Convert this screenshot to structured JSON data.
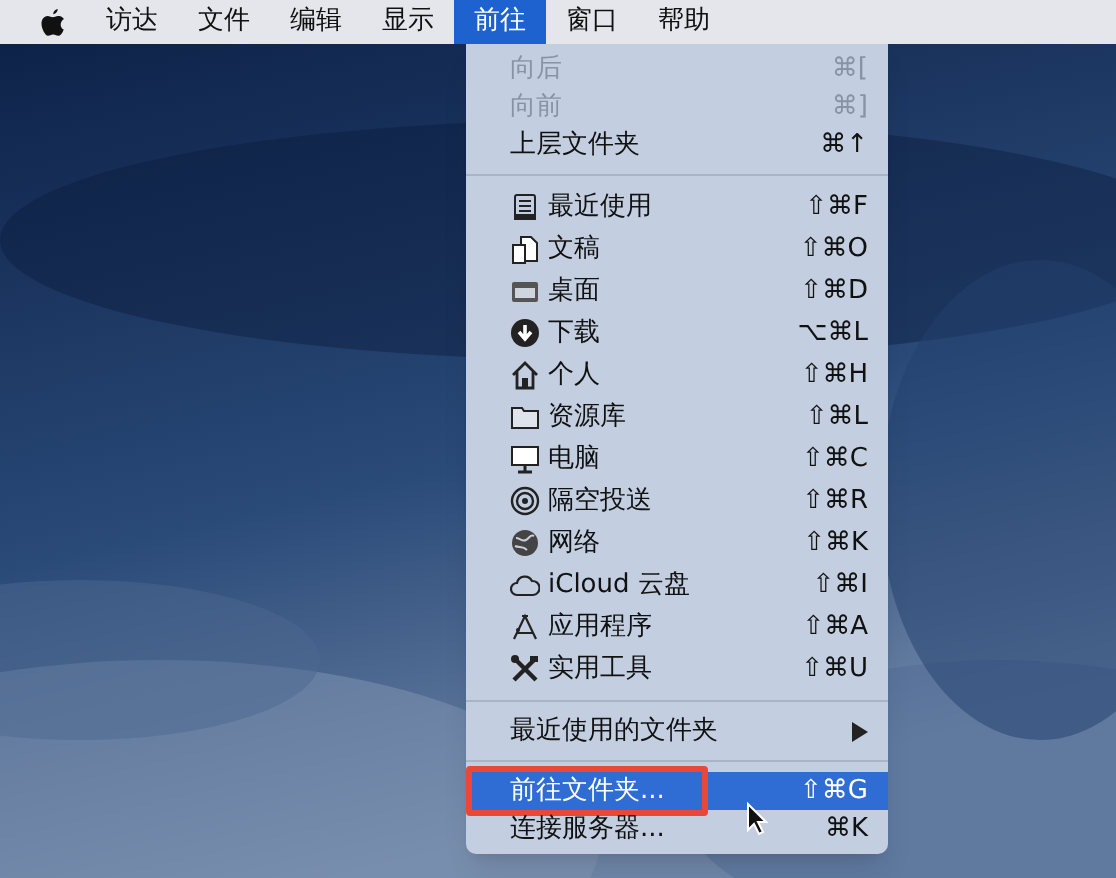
{
  "menu_bar": [
    {
      "label": "访达",
      "selected": false
    },
    {
      "label": "文件",
      "selected": false
    },
    {
      "label": "编辑",
      "selected": false
    },
    {
      "label": "显示",
      "selected": false
    },
    {
      "label": "前往",
      "selected": true
    },
    {
      "label": "窗口",
      "selected": false
    },
    {
      "label": "帮助",
      "selected": false
    }
  ],
  "menu": {
    "items": [
      {
        "kind": "item",
        "label": "向后",
        "shortcut": "⌘[",
        "disabled": true,
        "selected": false
      },
      {
        "kind": "item",
        "label": "向前",
        "shortcut": "⌘]",
        "disabled": true,
        "selected": false
      },
      {
        "kind": "item",
        "label": "上层文件夹",
        "shortcut": "⌘↑",
        "disabled": false,
        "selected": false
      },
      {
        "kind": "separator"
      },
      {
        "kind": "place",
        "label": "最近使用",
        "shortcut": "⇧⌘F",
        "disabled": false,
        "selected": false
      },
      {
        "kind": "place",
        "label": "文稿",
        "shortcut": "⇧⌘O",
        "disabled": false,
        "selected": false
      },
      {
        "kind": "place",
        "label": "桌面",
        "shortcut": "⇧⌘D",
        "disabled": false,
        "selected": false
      },
      {
        "kind": "place",
        "label": "下载",
        "shortcut": "⌥⌘L",
        "disabled": false,
        "selected": false
      },
      {
        "kind": "place",
        "label": "个人",
        "shortcut": "⇧⌘H",
        "disabled": false,
        "selected": false
      },
      {
        "kind": "place",
        "label": "资源库",
        "shortcut": "⇧⌘L",
        "disabled": false,
        "selected": false
      },
      {
        "kind": "place",
        "label": "电脑",
        "shortcut": "⇧⌘C",
        "disabled": false,
        "selected": false
      },
      {
        "kind": "place",
        "label": "隔空投送",
        "shortcut": "⇧⌘R",
        "disabled": false,
        "selected": false
      },
      {
        "kind": "place",
        "label": "网络",
        "shortcut": "⇧⌘K",
        "disabled": false,
        "selected": false
      },
      {
        "kind": "place",
        "label": "iCloud 云盘",
        "shortcut": "⇧⌘I",
        "disabled": false,
        "selected": false
      },
      {
        "kind": "place",
        "label": "应用程序",
        "shortcut": "⇧⌘A",
        "disabled": false,
        "selected": false
      },
      {
        "kind": "place",
        "label": "实用工具",
        "shortcut": "⇧⌘U",
        "disabled": false,
        "selected": false
      },
      {
        "kind": "separator"
      },
      {
        "kind": "submenu",
        "label": "最近使用的文件夹",
        "disabled": false,
        "selected": false
      },
      {
        "kind": "separator"
      },
      {
        "kind": "item",
        "label": "前往文件夹...",
        "shortcut": "⇧⌘G",
        "disabled": false,
        "selected": true,
        "highlighted": true
      },
      {
        "kind": "item",
        "label": "连接服务器...",
        "shortcut": "⌘K",
        "disabled": false,
        "selected": false
      }
    ]
  }
}
